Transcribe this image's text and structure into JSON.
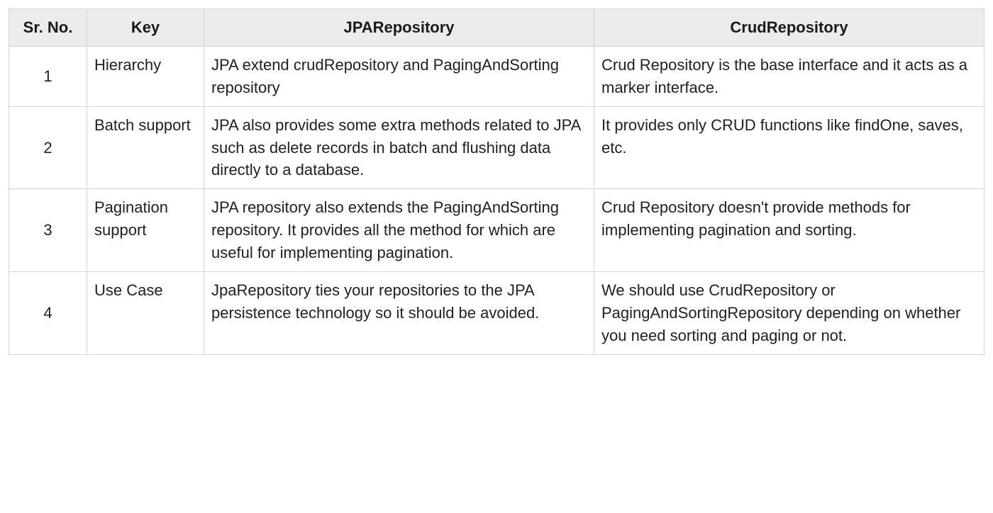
{
  "headers": {
    "srno": "Sr. No.",
    "key": "Key",
    "jpa": "JPARepository",
    "crud": "CrudRepository"
  },
  "rows": [
    {
      "srno": "1",
      "key": "Hierarchy",
      "jpa": "JPA extend crudRepository and PagingAndSorting repository",
      "crud": "Crud Repository is the base interface and it acts as a marker interface."
    },
    {
      "srno": "2",
      "key": "Batch support",
      "jpa": "JPA also provides some extra methods related to JPA such as delete records in batch and flushing data directly to a database.",
      "crud": "It provides only CRUD functions like findOne, saves, etc."
    },
    {
      "srno": "3",
      "key": "Pagination support",
      "jpa": "JPA repository also extends the PagingAndSorting repository. It provides all the method for which are useful for implementing pagination.",
      "crud": "Crud Repository doesn't provide methods for implementing pagination and sorting."
    },
    {
      "srno": "4",
      "key": "Use Case",
      "jpa": "JpaRepository ties your repositories to the JPA persistence technology so it should be avoided.",
      "crud": "We should use CrudRepository or PagingAndSortingRepository depending on whether you need sorting and paging or not."
    }
  ]
}
